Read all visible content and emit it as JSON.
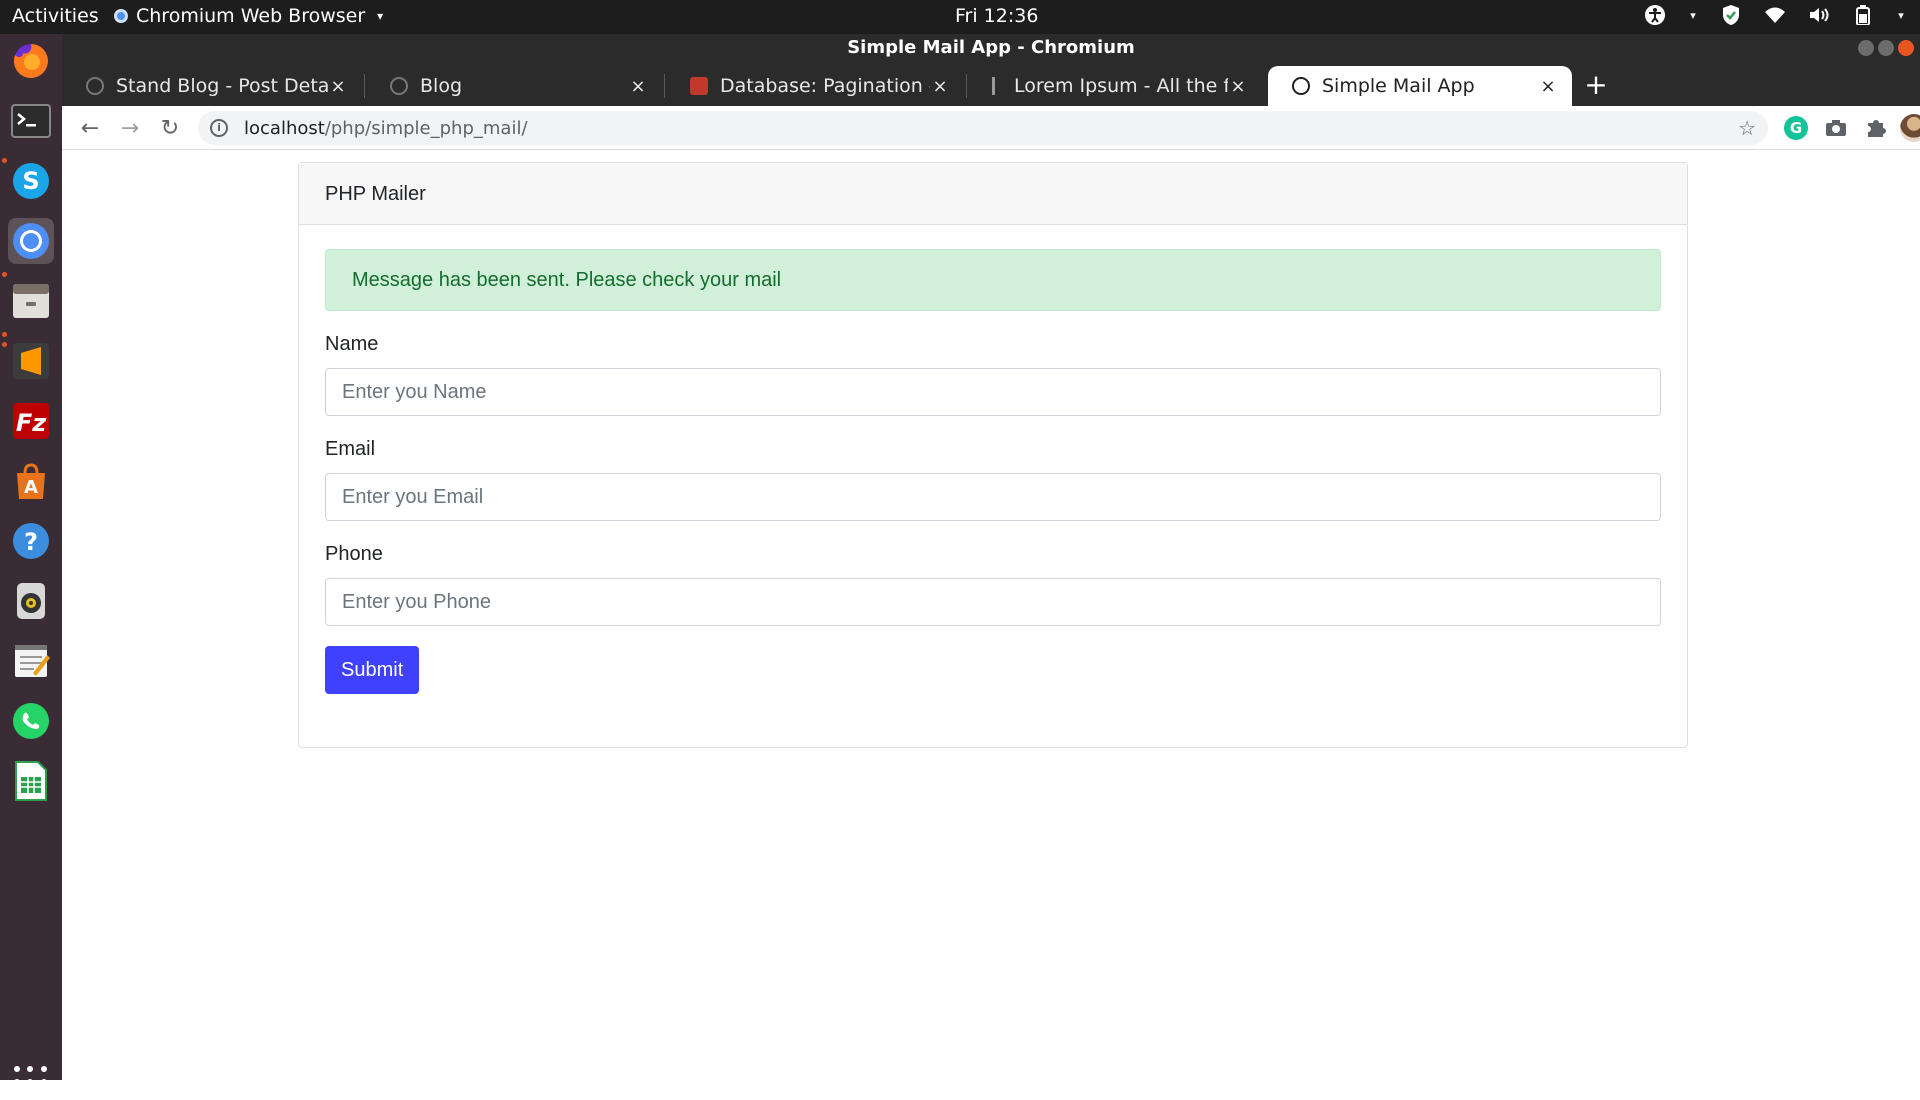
{
  "topbar": {
    "activities": "Activities",
    "app_name": "Chromium Web Browser",
    "clock": "Fri 12:36",
    "tray_icons": [
      "accessibility-icon",
      "shield-icon",
      "wifi-icon",
      "volume-icon",
      "battery-icon"
    ]
  },
  "dock": {
    "apps": [
      "firefox",
      "terminal",
      "skype",
      "chromium",
      "files",
      "sublime-text",
      "filezilla",
      "ubuntu-software",
      "help",
      "rhythmbox",
      "text-editor",
      "whatsapp",
      "libreoffice-calc",
      "show-applications"
    ]
  },
  "window": {
    "title": "Simple Mail App - Chromium"
  },
  "tabs": [
    {
      "title": "Stand Blog - Post Details",
      "close": "×"
    },
    {
      "title": "Blog",
      "close": "×"
    },
    {
      "title": "Database: Pagination - Laravel",
      "close": "×"
    },
    {
      "title": "Lorem Ipsum - All the facts - Lipsum generator",
      "close": "×"
    },
    {
      "title": "Simple Mail App",
      "close": "×",
      "active": true
    }
  ],
  "newtab": "+",
  "toolbar": {
    "back": "←",
    "forward": "→",
    "reload": "↻",
    "url_host": "localhost",
    "url_path": "/php/simple_php_mail/",
    "star": "☆"
  },
  "page": {
    "card_title": "PHP Mailer",
    "alert": "Message has been sent. Please check your mail",
    "fields": [
      {
        "label": "Name",
        "placeholder": "Enter you Name",
        "value": ""
      },
      {
        "label": "Email",
        "placeholder": "Enter you Email",
        "value": ""
      },
      {
        "label": "Phone",
        "placeholder": "Enter you Phone",
        "value": ""
      }
    ],
    "submit": "Submit"
  },
  "colors": {
    "alert_bg": "#d1f0da",
    "alert_text": "#146c2e",
    "submit_bg": "#4040ff",
    "ubuntu_accent": "#e95420"
  }
}
